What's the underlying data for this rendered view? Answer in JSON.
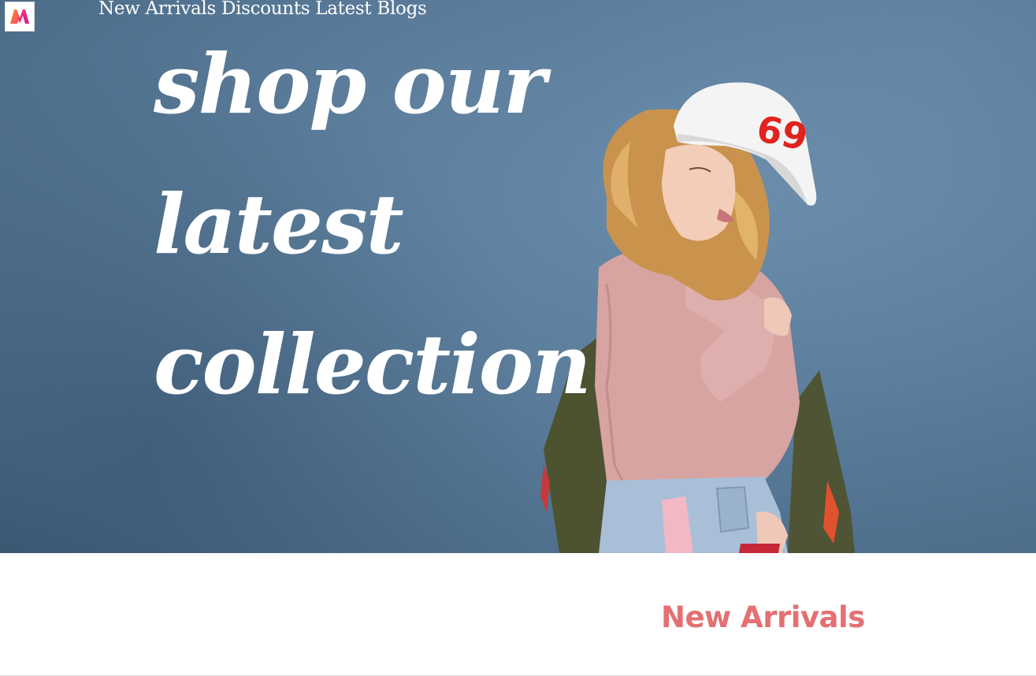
{
  "brand": {
    "logo_icon": "myntra-m-logo-icon",
    "logo_colors": [
      "#ff3f6c",
      "#f7931e",
      "#d1138a"
    ]
  },
  "nav": {
    "items": [
      {
        "label": "New Arrivals"
      },
      {
        "label": "Discounts"
      },
      {
        "label": "Latest Blogs"
      }
    ]
  },
  "hero": {
    "headline_line1": "shop our",
    "headline_line2": "latest",
    "headline_line3": "collection",
    "image_icon": "fashion-model-photo-icon",
    "cap_number": "69",
    "background_color": "#5c7e9c"
  },
  "section": {
    "title": "New Arrivals",
    "title_color": "#e56f73"
  }
}
